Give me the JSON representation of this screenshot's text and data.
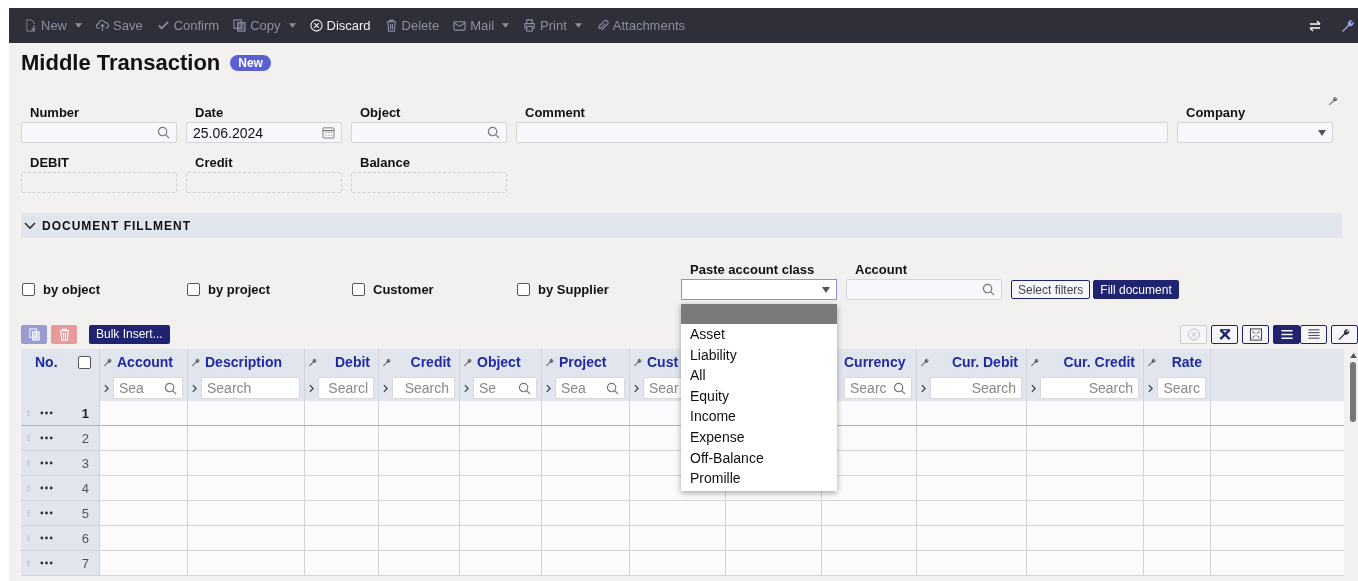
{
  "toolbar": {
    "items": [
      {
        "kind": "new",
        "label": "New",
        "dropdown": true,
        "disabled": true
      },
      {
        "kind": "save",
        "label": "Save",
        "dropdown": false,
        "disabled": true
      },
      {
        "kind": "confirm",
        "label": "Confirm",
        "dropdown": false,
        "disabled": true
      },
      {
        "kind": "copy",
        "label": "Copy",
        "dropdown": true,
        "disabled": true
      },
      {
        "kind": "discard",
        "label": "Discard",
        "dropdown": false,
        "disabled": false
      },
      {
        "kind": "delete",
        "label": "Delete",
        "dropdown": false,
        "disabled": true
      },
      {
        "kind": "mail",
        "label": "Mail",
        "dropdown": true,
        "disabled": true
      },
      {
        "kind": "print",
        "label": "Print",
        "dropdown": true,
        "disabled": true
      },
      {
        "kind": "attachments",
        "label": "Attachments",
        "dropdown": false,
        "disabled": true
      }
    ]
  },
  "title": "Middle Transaction",
  "badge": "New",
  "fields": [
    {
      "label": "Number",
      "kind": "lookup"
    },
    {
      "label": "Date",
      "kind": "date",
      "value": "25.06.2024"
    },
    {
      "label": "Object",
      "kind": "lookup"
    },
    {
      "label": "Comment",
      "kind": "text"
    },
    {
      "label": "Company",
      "kind": "select"
    }
  ],
  "totals": [
    {
      "label": "DEBIT"
    },
    {
      "label": "Credit"
    },
    {
      "label": "Balance"
    }
  ],
  "section": {
    "title": "DOCUMENT FILLMENT",
    "expanded": true
  },
  "checkboxes": [
    {
      "label": "by object",
      "checked": false
    },
    {
      "label": "by project",
      "checked": false
    },
    {
      "label": "Customer",
      "checked": false
    },
    {
      "label": "by Supplier",
      "checked": false
    }
  ],
  "paste_account_class": {
    "label": "Paste account class",
    "expanded": true,
    "options": [
      {
        "selected": true
      },
      {
        "label": "Asset",
        "selected": false
      },
      {
        "label": "Liability",
        "selected": false
      },
      {
        "label": "All",
        "selected": false
      },
      {
        "label": "Equity",
        "selected": false
      },
      {
        "label": "Income",
        "selected": false
      },
      {
        "label": "Expense",
        "selected": false
      },
      {
        "label": "Off-Balance",
        "selected": false
      },
      {
        "label": "Promille",
        "selected": false
      }
    ]
  },
  "account": {
    "label": "Account"
  },
  "buttons": [
    {
      "label": "Select filters",
      "primary": false
    },
    {
      "label": "Fill document",
      "primary": true
    }
  ],
  "grid": {
    "bulk_insert": "Bulk Insert...",
    "number_header": "No.",
    "all_checked": false,
    "view_modes": [
      {
        "selected": true
      },
      {
        "selected": false
      }
    ],
    "columns": [
      {
        "header": "Account",
        "kind": "lookup",
        "placeholder": "Sea"
      },
      {
        "header": "Description",
        "kind": "text",
        "placeholder": "Search"
      },
      {
        "header": "Debit",
        "kind": "number",
        "placeholder": "Searcl"
      },
      {
        "header": "Credit",
        "kind": "number",
        "placeholder": "Search"
      },
      {
        "header": "Object",
        "kind": "lookup",
        "placeholder": "Se"
      },
      {
        "header": "Project",
        "kind": "lookup",
        "placeholder": "Sea"
      },
      {
        "header": "Cust",
        "kind": "text",
        "placeholder": "Sear"
      },
      {
        "kind": "hidden"
      },
      {
        "header": "Currency",
        "kind": "lookup",
        "placeholder": "Searc"
      },
      {
        "header": "Cur. Debit",
        "kind": "number",
        "placeholder": "Search"
      },
      {
        "header": "Cur. Credit",
        "kind": "number",
        "placeholder": "Search"
      },
      {
        "header": "Rate",
        "kind": "number",
        "placeholder": "Searc"
      }
    ],
    "rows": [
      {
        "number": "1",
        "current": true
      },
      {
        "number": "2",
        "current": false
      },
      {
        "number": "3",
        "current": false
      },
      {
        "number": "4",
        "current": false
      },
      {
        "number": "5",
        "current": false
      },
      {
        "number": "6",
        "current": false
      },
      {
        "number": "7",
        "current": false
      }
    ]
  }
}
